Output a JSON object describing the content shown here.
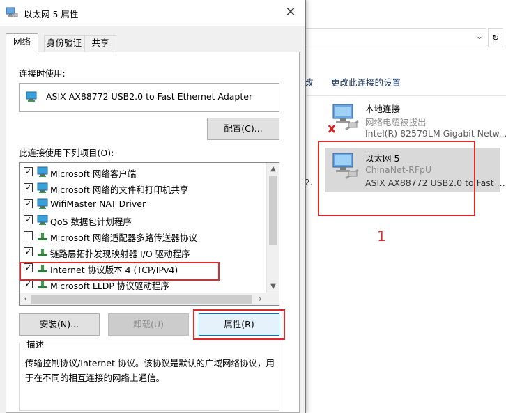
{
  "background": {
    "toolbar": {
      "truncated": "改",
      "change_settings": "更改此连接的设置"
    },
    "side_fragment": "2.",
    "connections": [
      {
        "name": "本地连接",
        "status": "网络电缆被拔出",
        "adapter": "Intel(R) 82579LM Gigabit Netw...",
        "state": "disconnected"
      },
      {
        "name": "以太网 5",
        "status": "ChinaNet-RFpU",
        "adapter": "ASIX AX88772 USB2.0 to Fast ...",
        "state": "selected"
      }
    ],
    "callout_number": "1"
  },
  "dialog": {
    "title": "以太网 5 属性",
    "tabs": [
      "网络",
      "身份验证",
      "共享"
    ],
    "connect_using_label": "连接时使用:",
    "adapter": "ASIX AX88772 USB2.0 to Fast Ethernet Adapter",
    "configure_button": "配置(C)...",
    "items_label": "此连接使用下列项目(O):",
    "items": [
      {
        "label": "Microsoft 网络客户端",
        "checked": true,
        "icon": "network-client-icon"
      },
      {
        "label": "Microsoft 网络的文件和打印机共享",
        "checked": true,
        "icon": "file-share-icon"
      },
      {
        "label": "WifiMaster NAT Driver",
        "checked": true,
        "icon": "network-driver-icon"
      },
      {
        "label": "QoS 数据包计划程序",
        "checked": true,
        "icon": "qos-icon"
      },
      {
        "label": "Microsoft 网络适配器多路传送器协议",
        "checked": false,
        "icon": "protocol-icon"
      },
      {
        "label": "链路层拓扑发现映射器 I/O 驱动程序",
        "checked": true,
        "icon": "protocol-icon"
      },
      {
        "label": "Internet 协议版本 4 (TCP/IPv4)",
        "checked": true,
        "icon": "protocol-icon"
      },
      {
        "label": "Microsoft LLDP 协议驱动程序",
        "checked": true,
        "icon": "protocol-icon"
      }
    ],
    "install_button": "安装(N)...",
    "uninstall_button": "卸载(U)",
    "properties_button": "属性(R)",
    "description_label": "描述",
    "description_text": "传输控制协议/Internet 协议。该协议是默认的广域网络协议，用于在不同的相互连接的网络上通信。"
  },
  "colors": {
    "highlight": "#e0292d",
    "selection": "#d9d9d9",
    "link": "#1e3a66"
  }
}
